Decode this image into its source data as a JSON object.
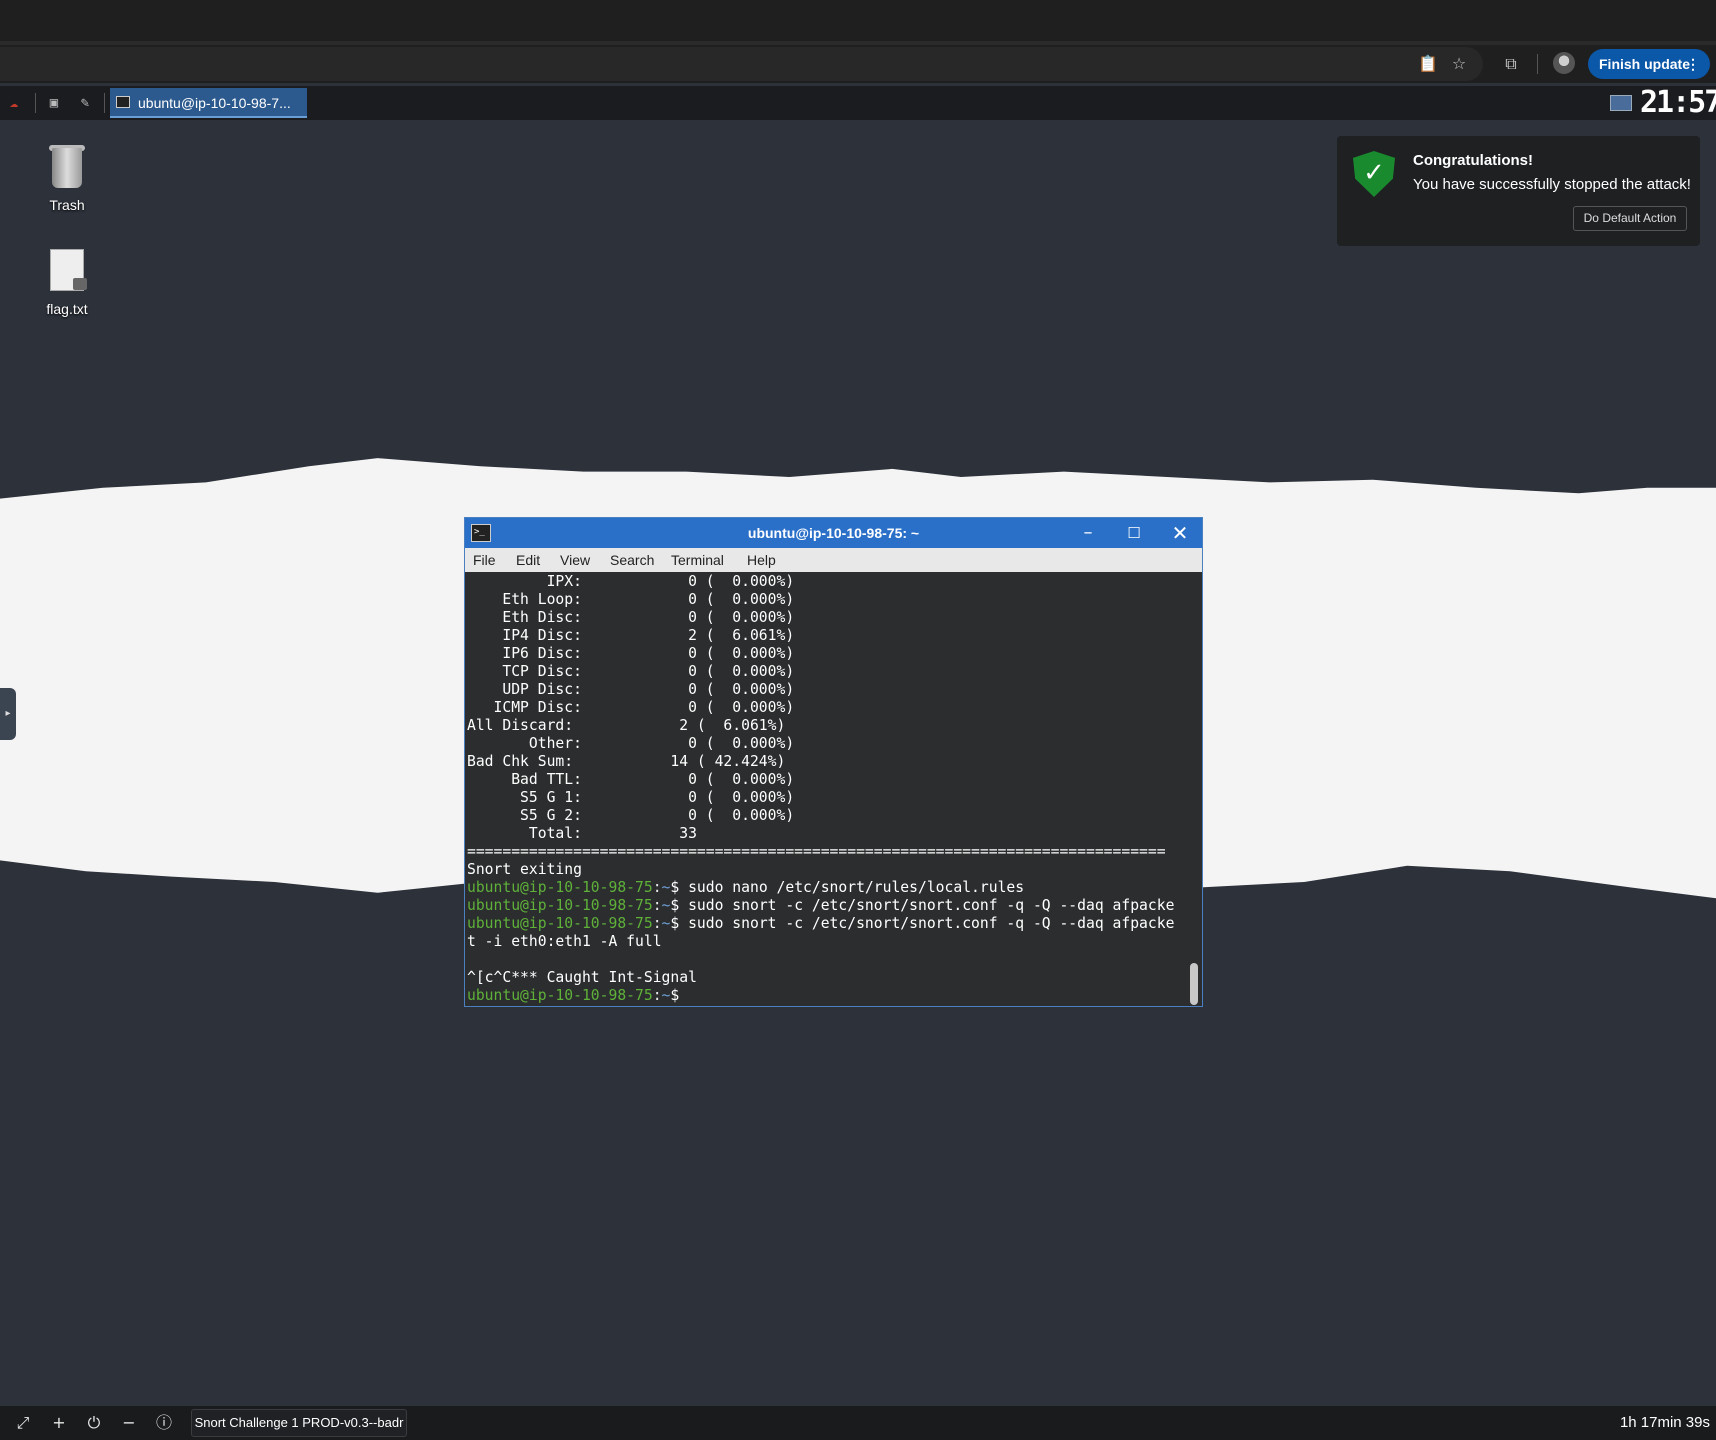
{
  "browser": {
    "finish_update_label": "Finish update",
    "icons": [
      "clipboard-icon",
      "bookmark-star-icon",
      "cast-search-icon",
      "profile-avatar-icon",
      "more-menu-icon"
    ]
  },
  "panel": {
    "task_label": "ubuntu@ip-10-10-98-7...",
    "clock": "21:57"
  },
  "desktop": {
    "icons": [
      {
        "label": "Trash"
      },
      {
        "label": "flag.txt"
      }
    ]
  },
  "notification": {
    "title": "Congratulations!",
    "body": "You have successfully stopped the attack!",
    "action": "Do Default Action"
  },
  "terminal": {
    "title": "ubuntu@ip-10-10-98-75: ~",
    "menu": [
      "File",
      "Edit",
      "View",
      "Search",
      "Terminal",
      "Help"
    ],
    "stats": [
      "         IPX:            0 (  0.000%)",
      "    Eth Loop:            0 (  0.000%)",
      "    Eth Disc:            0 (  0.000%)",
      "    IP4 Disc:            2 (  6.061%)",
      "    IP6 Disc:            0 (  0.000%)",
      "    TCP Disc:            0 (  0.000%)",
      "    UDP Disc:            0 (  0.000%)",
      "   ICMP Disc:            0 (  0.000%)",
      "All Discard:            2 (  6.061%)",
      "       Other:            0 (  0.000%)",
      "Bad Chk Sum:           14 ( 42.424%)",
      "     Bad TTL:            0 (  0.000%)",
      "      S5 G 1:            0 (  0.000%)",
      "      S5 G 2:            0 (  0.000%)",
      "       Total:           33"
    ],
    "separator": "===============================================================================",
    "exit_line": "Snort exiting",
    "prompt_user": "ubuntu@ip-10-10-98-75",
    "prompt_colon": ":",
    "prompt_path": "~",
    "prompt_dollar": "$",
    "commands": [
      " sudo nano /etc/snort/rules/local.rules",
      " sudo snort -c /etc/snort/snort.conf -q -Q --daq afpacke",
      " sudo snort -c /etc/snort/snort.conf -q -Q --daq afpacke"
    ],
    "wrap_line": "t -i eth0:eth1 -A full",
    "blank_line": "",
    "signal_line": "^[c^C*** Caught Int-Signal",
    "final_cursor": " "
  },
  "bottombar": {
    "session_label": "Snort Challenge 1 PROD-v0.3--badr",
    "timer": "1h 17min 39s"
  }
}
